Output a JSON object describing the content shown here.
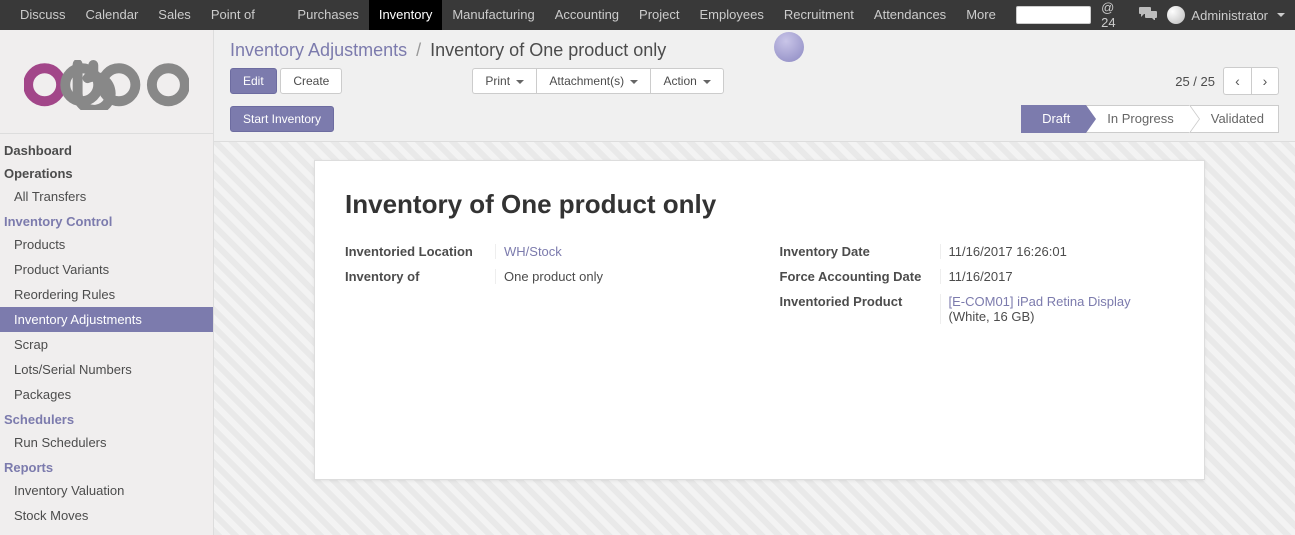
{
  "navbar": {
    "items": [
      "Discuss",
      "Calendar",
      "Sales",
      "Point of Sale",
      "Purchases",
      "Inventory",
      "Manufacturing",
      "Accounting",
      "Project",
      "Employees",
      "Recruitment",
      "Attendances"
    ],
    "active": "Inventory",
    "more": "More",
    "at_count": "24",
    "user_name": "Administrator"
  },
  "sidebar": {
    "dashboard": "Dashboard",
    "operations": "Operations",
    "operations_items": [
      "All Transfers"
    ],
    "inventory_control": "Inventory Control",
    "inventory_items": [
      "Products",
      "Product Variants",
      "Reordering Rules",
      "Inventory Adjustments",
      "Scrap",
      "Lots/Serial Numbers",
      "Packages"
    ],
    "inventory_active": "Inventory Adjustments",
    "schedulers": "Schedulers",
    "schedulers_items": [
      "Run Schedulers"
    ],
    "reports": "Reports",
    "reports_items": [
      "Inventory Valuation",
      "Stock Moves"
    ]
  },
  "breadcrumb": {
    "parent": "Inventory Adjustments",
    "current": "Inventory of One product only"
  },
  "buttons": {
    "edit": "Edit",
    "create": "Create",
    "print": "Print",
    "attachments": "Attachment(s)",
    "action": "Action",
    "start_inventory": "Start Inventory"
  },
  "pager": {
    "text": "25 / 25"
  },
  "status": {
    "draft": "Draft",
    "in_progress": "In Progress",
    "validated": "Validated"
  },
  "form": {
    "title": "Inventory of One product only",
    "labels": {
      "location": "Inventoried Location",
      "inventory_of": "Inventory of",
      "date": "Inventory Date",
      "force_date": "Force Accounting Date",
      "product": "Inventoried Product"
    },
    "values": {
      "location": "WH/Stock",
      "inventory_of": "One product only",
      "date": "11/16/2017 16:26:01",
      "force_date": "11/16/2017",
      "product_link": "[E-COM01] iPad Retina Display",
      "product_extra": "(White, 16 GB)"
    }
  }
}
